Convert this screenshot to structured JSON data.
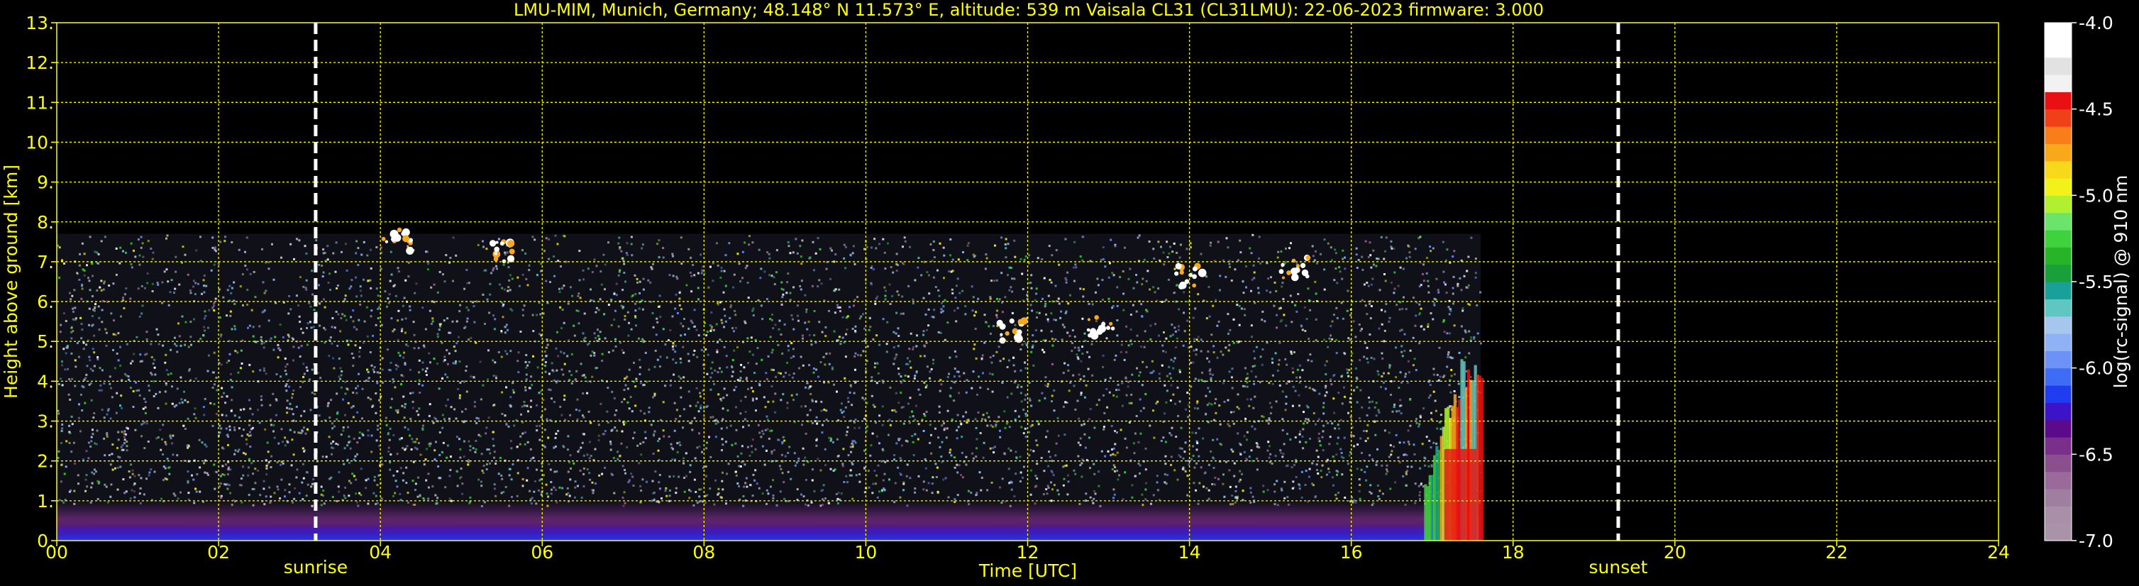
{
  "chart_data": {
    "type": "heatmap",
    "title": "LMU-MIM, Munich, Germany; 48.148° N 11.573° E, altitude: 539 m    Vaisala CL31 (CL31LMU): 22-06-2023    firmware: 3.000",
    "xlabel": "Time [UTC]",
    "ylabel": "Height above ground [km]",
    "xlim": [
      0,
      24
    ],
    "ylim": [
      0,
      13
    ],
    "x_ticks": [
      {
        "value": 0,
        "label": "00"
      },
      {
        "value": 2,
        "label": "02"
      },
      {
        "value": 4,
        "label": "04"
      },
      {
        "value": 6,
        "label": "06"
      },
      {
        "value": 8,
        "label": "08"
      },
      {
        "value": 10,
        "label": "10"
      },
      {
        "value": 12,
        "label": "12"
      },
      {
        "value": 14,
        "label": "14"
      },
      {
        "value": 16,
        "label": "16"
      },
      {
        "value": 18,
        "label": "18"
      },
      {
        "value": 20,
        "label": "20"
      },
      {
        "value": 22,
        "label": "22"
      },
      {
        "value": 24,
        "label": "24"
      }
    ],
    "y_ticks": [
      {
        "value": 0,
        "label": "0."
      },
      {
        "value": 1,
        "label": "1."
      },
      {
        "value": 2,
        "label": "2."
      },
      {
        "value": 3,
        "label": "3."
      },
      {
        "value": 4,
        "label": "4."
      },
      {
        "value": 5,
        "label": "5."
      },
      {
        "value": 6,
        "label": "6."
      },
      {
        "value": 7,
        "label": "7."
      },
      {
        "value": 8,
        "label": "8."
      },
      {
        "value": 9,
        "label": "9."
      },
      {
        "value": 10,
        "label": "10."
      },
      {
        "value": 11,
        "label": "11."
      },
      {
        "value": 12,
        "label": "12."
      },
      {
        "value": 13,
        "label": "13."
      }
    ],
    "grid": true,
    "data_coverage": {
      "time_start": 0,
      "time_end": 17.6,
      "height_max_km": 7.7
    },
    "sun_events": [
      {
        "label": "sunrise",
        "time": 3.2
      },
      {
        "label": "sunset",
        "time": 19.3
      }
    ],
    "features": {
      "boundary_layer_top_km": 1.0,
      "near_surface_layer_top_km": 0.35,
      "strong_signal_region": {
        "time_start": 16.9,
        "time_end": 17.6,
        "height_min_km": 0,
        "height_max_km": 4.6
      },
      "cloud_patches": [
        {
          "time": 4.2,
          "height_km": 7.5
        },
        {
          "time": 5.5,
          "height_km": 7.3
        },
        {
          "time": 11.8,
          "height_km": 5.3
        },
        {
          "time": 12.9,
          "height_km": 5.4
        },
        {
          "time": 14.0,
          "height_km": 6.6
        },
        {
          "time": 15.3,
          "height_km": 6.8
        }
      ]
    },
    "colorbar": {
      "label": "log(rc-signal) @ 910 nm",
      "min": -7.0,
      "max": -4.0,
      "ticks": [
        {
          "value": -4.0,
          "label": "-4.0"
        },
        {
          "value": -4.5,
          "label": "-4.5"
        },
        {
          "value": -5.0,
          "label": "-5.0"
        },
        {
          "value": -5.5,
          "label": "-5.5"
        },
        {
          "value": -6.0,
          "label": "-6.0"
        },
        {
          "value": -6.5,
          "label": "-6.5"
        },
        {
          "value": -7.0,
          "label": "-7.0"
        }
      ],
      "colors": [
        "#a993a9",
        "#a990a9",
        "#9f7fa0",
        "#9a6a9a",
        "#8a4f8c",
        "#7a2f8a",
        "#5a0a8a",
        "#3b14c8",
        "#1f3cf0",
        "#3f6cf5",
        "#6c91f7",
        "#8fb2f7",
        "#a6c6ee",
        "#5fc6c0",
        "#1aa09a",
        "#1aa03a",
        "#28b428",
        "#3ed23e",
        "#6ae46a",
        "#b0f030",
        "#f2f21a",
        "#f8d81a",
        "#f8a81a",
        "#f87e1a",
        "#f0401a",
        "#e81010",
        "#f2f2f2",
        "#e2e2e2",
        "#ffffff",
        "#ffffff"
      ]
    },
    "colors": {
      "text": "#ffff00",
      "grid": "#ffff00",
      "background": "#000000",
      "sun_line": "#ffffff",
      "colorbar_label": "#ffffff"
    }
  }
}
